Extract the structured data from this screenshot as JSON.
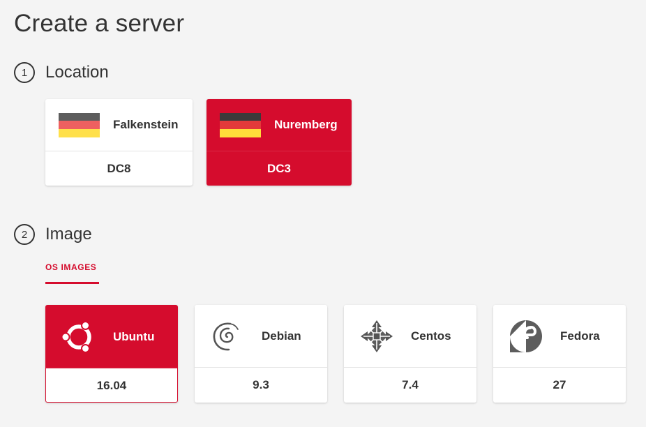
{
  "page": {
    "title": "Create a server"
  },
  "location_step": {
    "number": "1",
    "title": "Location",
    "cards": [
      {
        "name": "Falkenstein",
        "datacenter": "DC8",
        "selected": false
      },
      {
        "name": "Nuremberg",
        "datacenter": "DC3",
        "selected": true
      }
    ]
  },
  "image_step": {
    "number": "2",
    "title": "Image",
    "tabs": [
      {
        "label": "OS IMAGES",
        "active": true
      }
    ],
    "cards": [
      {
        "name": "Ubuntu",
        "version": "16.04",
        "icon": "ubuntu-icon",
        "selected": true
      },
      {
        "name": "Debian",
        "version": "9.3",
        "icon": "debian-icon",
        "selected": false
      },
      {
        "name": "Centos",
        "version": "7.4",
        "icon": "centos-icon",
        "selected": false
      },
      {
        "name": "Fedora",
        "version": "27",
        "icon": "fedora-icon",
        "selected": false
      }
    ]
  },
  "colors": {
    "accent": "#d50c2d",
    "background": "#f4f4f4",
    "flag_black": "#3a3a3a",
    "flag_red": "#dd0000",
    "flag_gold": "#ffce00"
  }
}
